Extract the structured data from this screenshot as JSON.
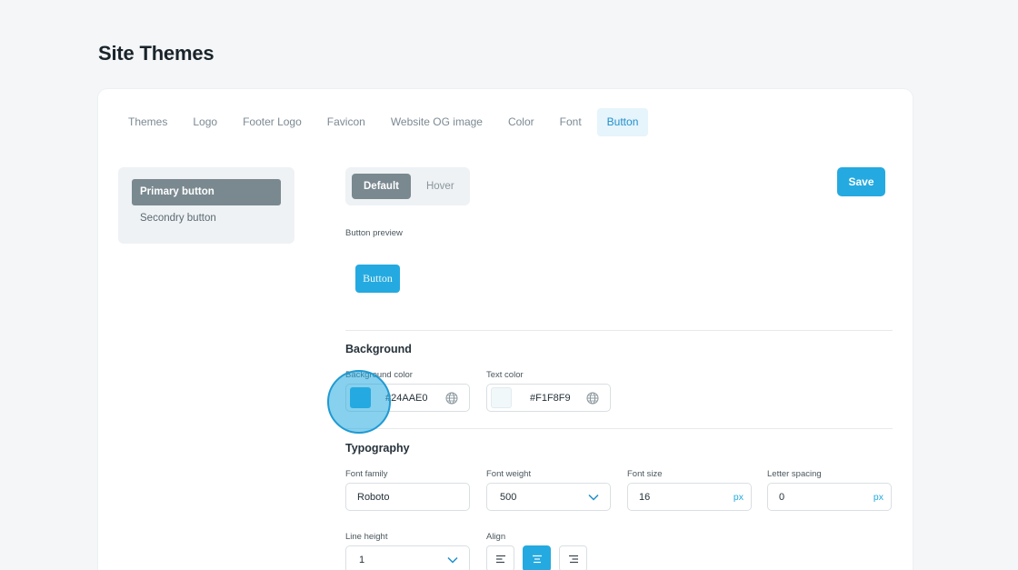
{
  "page": {
    "title": "Site Themes"
  },
  "tabs": [
    "Themes",
    "Logo",
    "Footer Logo",
    "Favicon",
    "Website OG image",
    "Color",
    "Font",
    "Button"
  ],
  "active_tab": "Button",
  "subnav": {
    "items": [
      "Primary button",
      "Secondry button"
    ],
    "active": "Primary button"
  },
  "state_toggle": {
    "options": [
      "Default",
      "Hover"
    ],
    "active": "Default"
  },
  "save_label": "Save",
  "preview": {
    "label": "Button preview",
    "button_text": "Button"
  },
  "background": {
    "title": "Background",
    "bg_color_label": "Background color",
    "bg_color_value": "#24AAE0",
    "text_color_label": "Text color",
    "text_color_value": "#F1F8F9"
  },
  "typography": {
    "title": "Typography",
    "font_family_label": "Font family",
    "font_family_value": "Roboto",
    "font_weight_label": "Font weight",
    "font_weight_value": "500",
    "font_size_label": "Font size",
    "font_size_value": "16",
    "font_size_unit": "px",
    "letter_spacing_label": "Letter spacing",
    "letter_spacing_value": "0",
    "letter_spacing_unit": "px",
    "line_height_label": "Line height",
    "line_height_value": "1",
    "align_label": "Align",
    "align_options": [
      "align-left-icon",
      "align-center-icon",
      "align-right-icon"
    ],
    "align_active": "align-center-icon"
  },
  "colors": {
    "accent": "#24AAE0",
    "subnav_active": "#7A8990"
  }
}
